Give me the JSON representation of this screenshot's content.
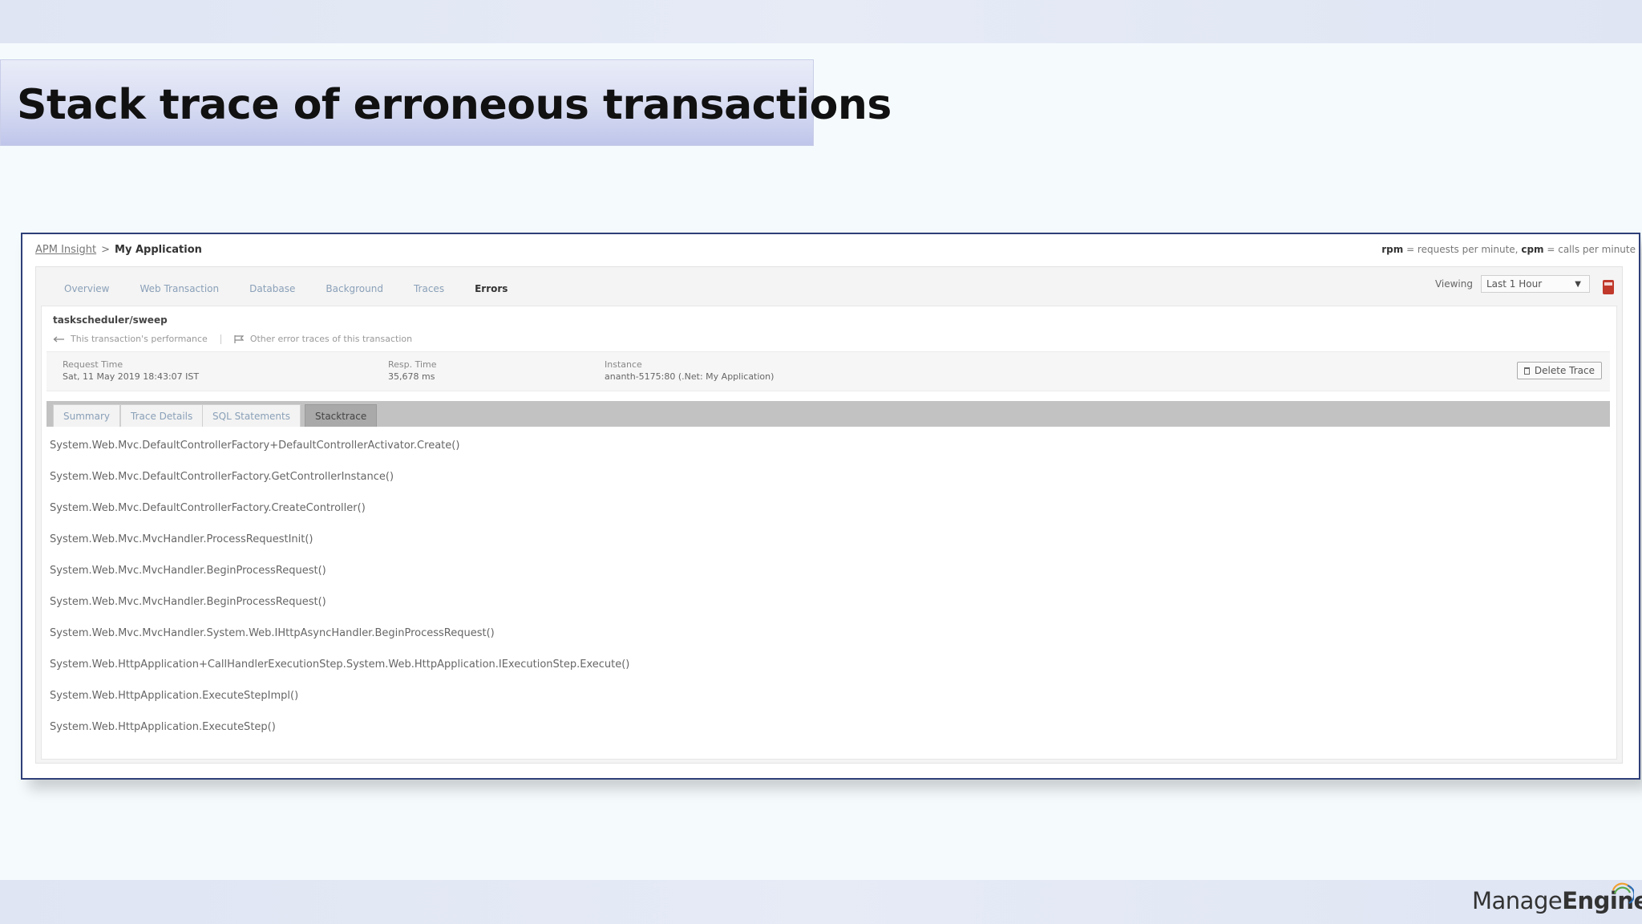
{
  "slide": {
    "title": "Stack trace of erroneous transactions",
    "logo_text_a": "Manage",
    "logo_text_b": "Engine"
  },
  "app": {
    "breadcrumb": {
      "link": "APM Insight",
      "separator": ">",
      "current": "My Application"
    },
    "legend": {
      "rpm_key": "rpm",
      "rpm_text": " = requests per minute, ",
      "cpm_key": "cpm",
      "cpm_text": " = calls per minute"
    },
    "nav_tabs": [
      {
        "label": "Overview",
        "active": false
      },
      {
        "label": "Web Transaction",
        "active": false
      },
      {
        "label": "Database",
        "active": false
      },
      {
        "label": "Background",
        "active": false
      },
      {
        "label": "Traces",
        "active": false
      },
      {
        "label": "Errors",
        "active": true
      }
    ],
    "viewing": {
      "label": "Viewing",
      "selected": "Last 1 Hour"
    },
    "transaction": {
      "name": "taskscheduler/sweep",
      "perf_link": "This transaction's performance",
      "other_link": "Other error traces of this transaction"
    },
    "info": {
      "request_time_label": "Request Time",
      "request_time_value": "Sat, 11 May 2019 18:43:07 IST",
      "resp_time_label": "Resp. Time",
      "resp_time_value": "35,678 ms",
      "instance_label": "Instance",
      "instance_value": "ananth-5175:80 (.Net: My Application)",
      "delete_label": "Delete Trace"
    },
    "sub_tabs": [
      {
        "label": "Summary",
        "active": false
      },
      {
        "label": "Trace Details",
        "active": false
      },
      {
        "label": "SQL Statements",
        "active": false
      },
      {
        "label": "Stacktrace",
        "active": true
      }
    ],
    "stacktrace": [
      "System.Web.Mvc.DefaultControllerFactory+DefaultControllerActivator.Create()",
      "System.Web.Mvc.DefaultControllerFactory.GetControllerInstance()",
      "System.Web.Mvc.DefaultControllerFactory.CreateController()",
      "System.Web.Mvc.MvcHandler.ProcessRequestInit()",
      "System.Web.Mvc.MvcHandler.BeginProcessRequest()",
      "System.Web.Mvc.MvcHandler.BeginProcessRequest()",
      "System.Web.Mvc.MvcHandler.System.Web.IHttpAsyncHandler.BeginProcessRequest()",
      "System.Web.HttpApplication+CallHandlerExecutionStep.System.Web.HttpApplication.IExecutionStep.Execute()",
      "System.Web.HttpApplication.ExecuteStepImpl()",
      "System.Web.HttpApplication.ExecuteStep()"
    ]
  },
  "icons": {
    "back": "arrow-left-icon",
    "flag": "flag-icon",
    "dropdown": "chevron-down-icon",
    "pdf": "pdf-icon",
    "trash": "trash-icon",
    "logo_arc": "logo-arc-icon"
  },
  "colors": {
    "frame_border": "#2f3f78",
    "title_gradient_end": "#bfc5ea",
    "tab_link": "#8aa0b8",
    "pdf_red": "#c0392b",
    "logo_green": "#58a94b",
    "logo_blue": "#2a6db5",
    "logo_orange": "#f0a030"
  }
}
